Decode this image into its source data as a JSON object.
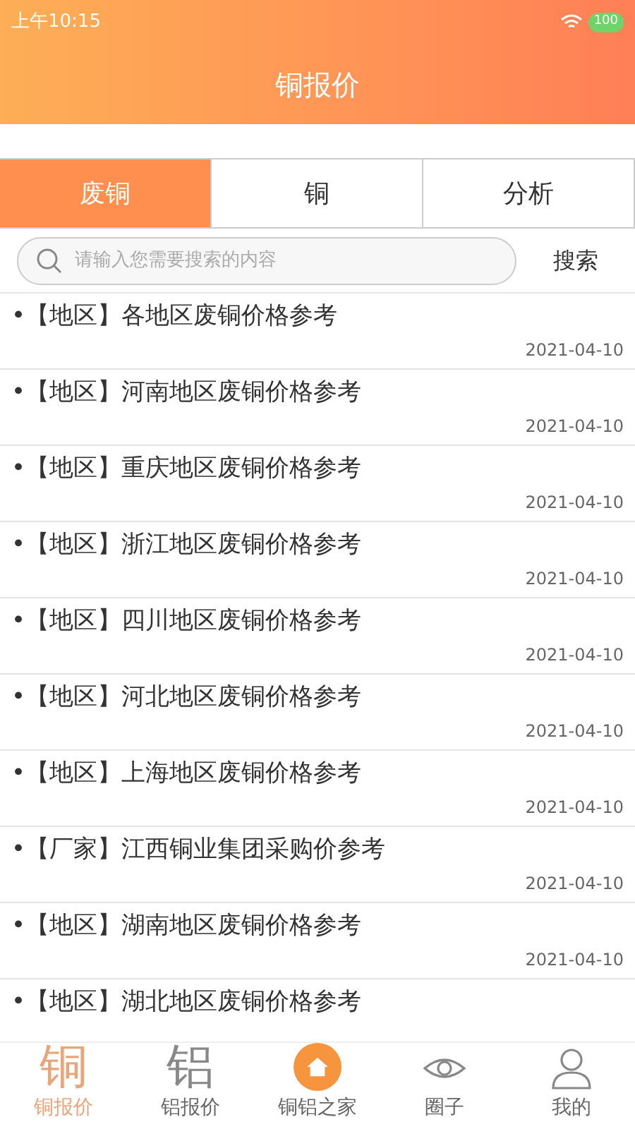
{
  "status_bar": {
    "time": "上午10:15",
    "battery": "100"
  },
  "header": {
    "title": "铜报价"
  },
  "tabs": [
    {
      "label": "废铜",
      "selected": true
    },
    {
      "label": "铜",
      "selected": false
    },
    {
      "label": "分析",
      "selected": false
    }
  ],
  "search": {
    "placeholder": "请输入您需要搜索的内容",
    "button": "搜索"
  },
  "items": [
    {
      "title": "•【地区】各地区废铜价格参考",
      "date": "2021-04-10"
    },
    {
      "title": "•【地区】河南地区废铜价格参考",
      "date": "2021-04-10"
    },
    {
      "title": "•【地区】重庆地区废铜价格参考",
      "date": "2021-04-10"
    },
    {
      "title": "•【地区】浙江地区废铜价格参考",
      "date": "2021-04-10"
    },
    {
      "title": "•【地区】四川地区废铜价格参考",
      "date": "2021-04-10"
    },
    {
      "title": "•【地区】河北地区废铜价格参考",
      "date": "2021-04-10"
    },
    {
      "title": "•【地区】上海地区废铜价格参考",
      "date": "2021-04-10"
    },
    {
      "title": "•【厂家】江西铜业集团采购价参考",
      "date": "2021-04-10"
    },
    {
      "title": "•【地区】湖南地区废铜价格参考",
      "date": "2021-04-10"
    },
    {
      "title": "•【地区】湖北地区废铜价格参考"
    }
  ],
  "bottom_nav": [
    {
      "kind": "glyph",
      "glyph": "铜",
      "label": "铜报价",
      "selected": true
    },
    {
      "kind": "glyph",
      "glyph": "铝",
      "label": "铝报价",
      "selected": false
    },
    {
      "kind": "home",
      "label": "铜铝之家",
      "selected": false
    },
    {
      "kind": "eye",
      "label": "圈子",
      "selected": false
    },
    {
      "kind": "user",
      "label": "我的",
      "selected": false
    }
  ]
}
